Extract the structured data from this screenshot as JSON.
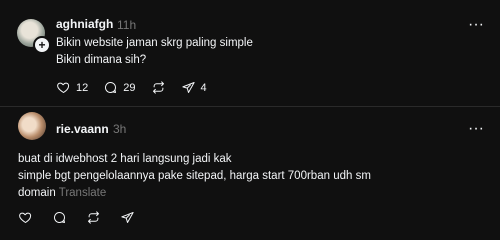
{
  "posts": [
    {
      "username": "aghniafgh",
      "time": "11h",
      "lines": [
        "Bikin website jaman skrg paling simple",
        "Bikin dimana sih?"
      ],
      "actions": {
        "likes": "12",
        "comments": "29",
        "reposts": "",
        "shares": "4"
      }
    },
    {
      "username": "rie.vaann",
      "time": "3h",
      "lines": [
        "buat di idwebhost 2 hari langsung jadi kak",
        "simple bgt pengelolaannya pake sitepad, harga start 700rban udh sm",
        "domain"
      ],
      "translate": "Translate",
      "actions": {
        "likes": "",
        "comments": "",
        "reposts": "",
        "shares": ""
      }
    }
  ],
  "more_label": "···",
  "follow_badge": "+"
}
